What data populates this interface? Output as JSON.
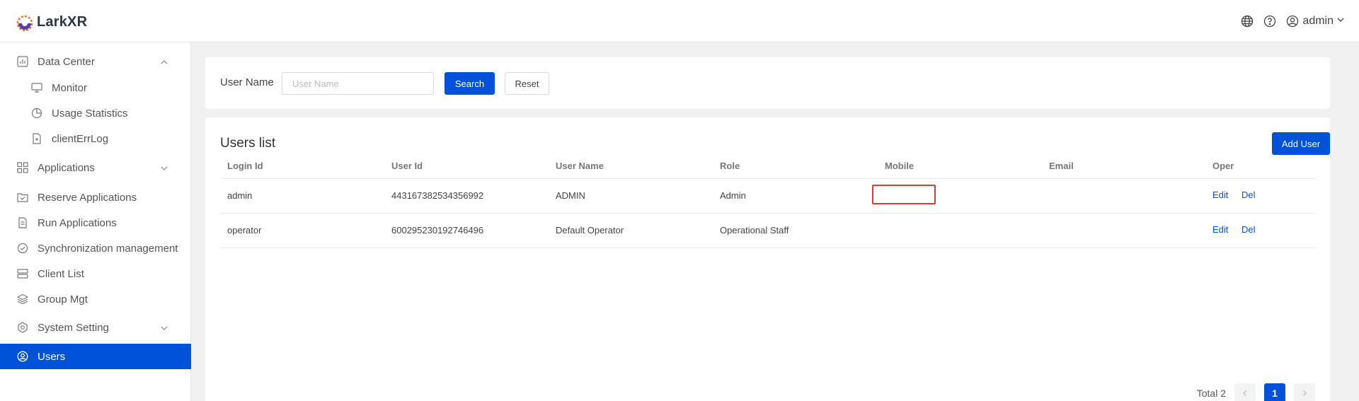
{
  "header": {
    "brand": "LarkXR",
    "user_name": "admin"
  },
  "sidebar": {
    "items": [
      {
        "label": "Data Center",
        "icon": "chart-panel-icon"
      },
      {
        "label": "Monitor",
        "icon": "monitor-icon"
      },
      {
        "label": "Usage Statistics",
        "icon": "pie-chart-icon"
      },
      {
        "label": "clientErrLog",
        "icon": "file-icon"
      },
      {
        "label": "Applications",
        "icon": "grid-icon"
      },
      {
        "label": "Reserve Applications",
        "icon": "folder-icon"
      },
      {
        "label": "Run Applications",
        "icon": "document-icon"
      },
      {
        "label": "Synchronization management",
        "icon": "check-circle-icon"
      },
      {
        "label": "Client List",
        "icon": "server-icon"
      },
      {
        "label": "Group Mgt",
        "icon": "layers-icon"
      },
      {
        "label": "System Setting",
        "icon": "settings-icon"
      },
      {
        "label": "Users",
        "icon": "user-circle-icon"
      }
    ],
    "active": "Users"
  },
  "search": {
    "label": "User Name",
    "placeholder": "User Name",
    "value": "",
    "search_button": "Search",
    "reset_button": "Reset"
  },
  "users": {
    "title": "Users list",
    "add_button": "Add User",
    "columns": [
      "Login Id",
      "User Id",
      "User Name",
      "Role",
      "Mobile",
      "Email",
      "Oper"
    ],
    "rows": [
      {
        "login_id": "admin",
        "user_id": "443167382534356992",
        "user_name": "ADMIN",
        "role": "Admin",
        "mobile": "",
        "email": "",
        "edit": "Edit",
        "del": "Del"
      },
      {
        "login_id": "operator",
        "user_id": "600295230192746496",
        "user_name": "Default Operator",
        "role": "Operational Staff",
        "mobile": "",
        "email": "",
        "edit": "Edit",
        "del": "Del"
      }
    ]
  },
  "pagination": {
    "total_text": "Total 2",
    "current_page": "1"
  },
  "colors": {
    "primary": "#0052d9",
    "highlight": "#e53935"
  }
}
